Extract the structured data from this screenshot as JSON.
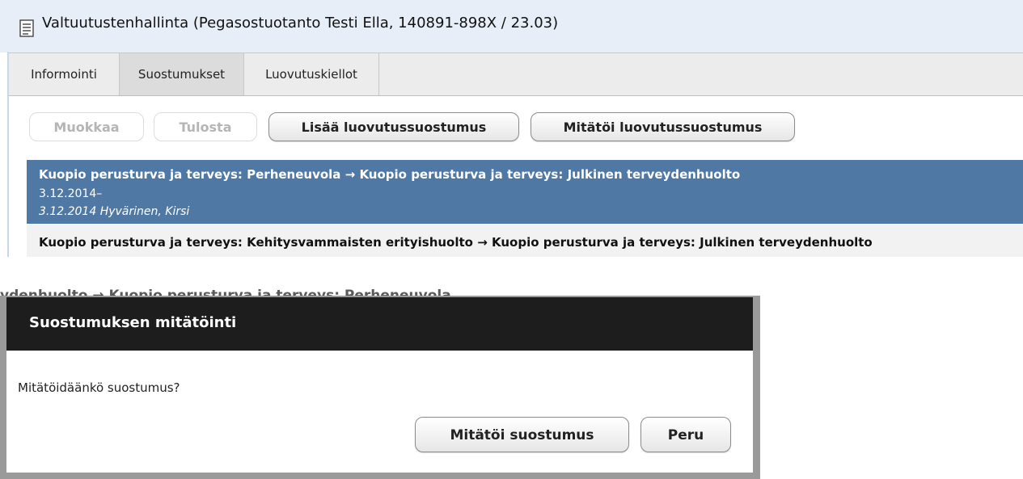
{
  "window": {
    "title": "Valtuutustenhallinta (Pegasostuotanto Testi Ella, 140891-898X / 23.03)",
    "icon": "document-icon"
  },
  "tabs": [
    {
      "label": "Informointi",
      "active": false
    },
    {
      "label": "Suostumukset",
      "active": true
    },
    {
      "label": "Luovutuskiellot",
      "active": false
    }
  ],
  "toolbar": {
    "edit_label": "Muokkaa",
    "print_label": "Tulosta",
    "add_label": "Lisää luovutussuostumus",
    "revoke_label": "Mitätöi luovutussuostumus"
  },
  "consents": [
    {
      "title": "Kuopio perusturva ja terveys: Perheneuvola → Kuopio perusturva ja terveys: Julkinen terveydenhuolto",
      "validity": "3.12.2014–",
      "recorded": "3.12.2014 Hyvärinen, Kirsi",
      "selected": true
    },
    {
      "title": "Kuopio perusturva ja terveys: Kehitysvammaisten erityishuolto → Kuopio perusturva ja terveys: Julkinen terveydenhuolto",
      "selected": false
    }
  ],
  "dialog_background_text": "ydenhuolto → Kuopio perusturva ja terveys: Perheneuvola",
  "dialog": {
    "title": "Suostumuksen mitätöinti",
    "message": "Mitätöidäänkö suostumus?",
    "confirm_label": "Mitätöi suostumus",
    "cancel_label": "Peru"
  },
  "colors": {
    "selected_row": "#4f79a4",
    "dialog_header": "#1d1d1d",
    "titlebar": "#e7eef8"
  }
}
